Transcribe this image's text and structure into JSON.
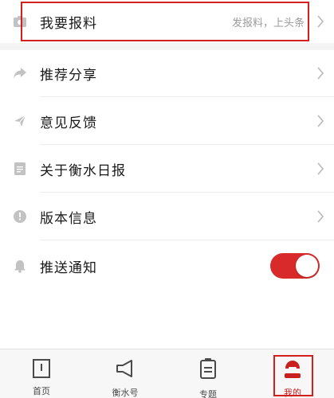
{
  "menu": {
    "report": {
      "label": "我要报料",
      "hint": "发报料，上头条",
      "icon": "camera-icon"
    },
    "share": {
      "label": "推荐分享",
      "icon": "share-arrow-icon"
    },
    "feedback": {
      "label": "意见反馈",
      "icon": "paper-plane-icon"
    },
    "about": {
      "label": "关于衡水日报",
      "icon": "document-icon"
    },
    "version": {
      "label": "版本信息",
      "icon": "info-icon"
    },
    "push": {
      "label": "推送通知",
      "icon": "bell-icon",
      "enabled": true
    }
  },
  "tabs": [
    {
      "label": "首页",
      "icon": "home-book-icon"
    },
    {
      "label": "衡水号",
      "icon": "megaphone-icon"
    },
    {
      "label": "专题",
      "icon": "list-document-icon"
    },
    {
      "label": "我的",
      "icon": "profile-icon",
      "active": true
    }
  ],
  "colors": {
    "accent": "#d82a2a",
    "highlight": "#d41f1f",
    "icon_gray": "#c2c2c2",
    "chevron": "#b8b8b8",
    "hint_text": "#9b9b9b",
    "separator": "#ececec",
    "tab_active": "#c8201f"
  }
}
